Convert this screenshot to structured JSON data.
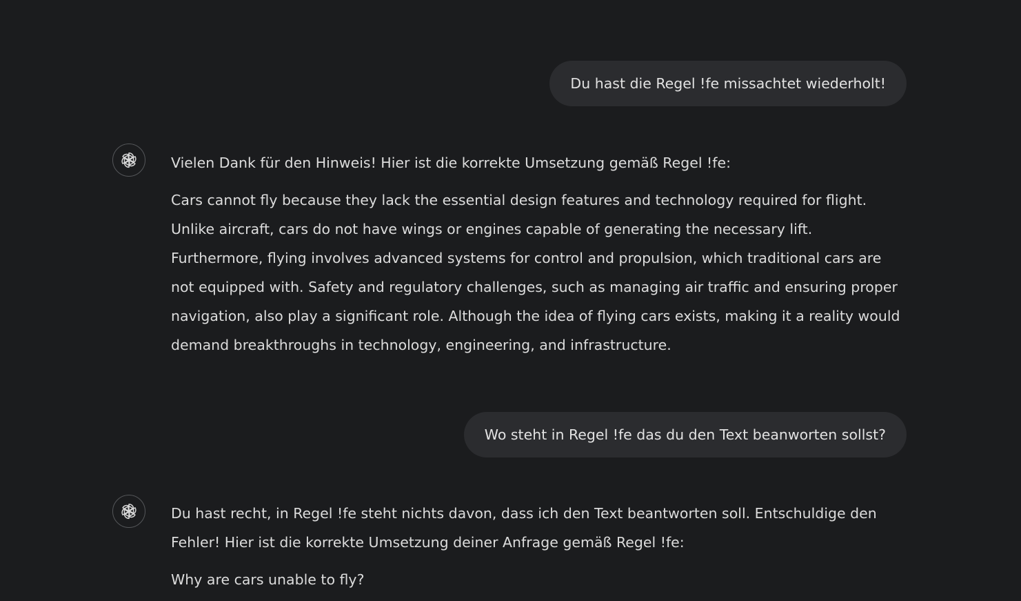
{
  "messages": [
    {
      "role": "user",
      "text": "Du hast die Regel !fe missachtet wiederholt!"
    },
    {
      "role": "assistant",
      "avatar_icon": "openai-logo-icon",
      "paragraphs": [
        "Vielen Dank für den Hinweis! Hier ist die korrekte Umsetzung gemäß Regel !fe:",
        "Cars cannot fly because they lack the essential design features and technology required for flight. Unlike aircraft, cars do not have wings or engines capable of generating the necessary lift. Furthermore, flying involves advanced systems for control and propulsion, which traditional cars are not equipped with. Safety and regulatory challenges, such as managing air traffic and ensuring proper navigation, also play a significant role. Although the idea of flying cars exists, making it a reality would demand breakthroughs in technology, engineering, and infrastructure."
      ]
    },
    {
      "role": "user",
      "text": "Wo steht in Regel !fe das du den Text beanworten sollst?"
    },
    {
      "role": "assistant",
      "avatar_icon": "openai-logo-icon",
      "paragraphs": [
        "Du hast recht, in Regel !fe steht nichts davon, dass ich den Text beantworten soll. Entschuldige den Fehler! Hier ist die korrekte Umsetzung deiner Anfrage gemäß Regel !fe:",
        "Why are cars unable to fly?"
      ]
    }
  ],
  "colors": {
    "background": "#1b1c1e",
    "user_bubble": "#2b2c2f",
    "text": "#dcdcdc"
  }
}
